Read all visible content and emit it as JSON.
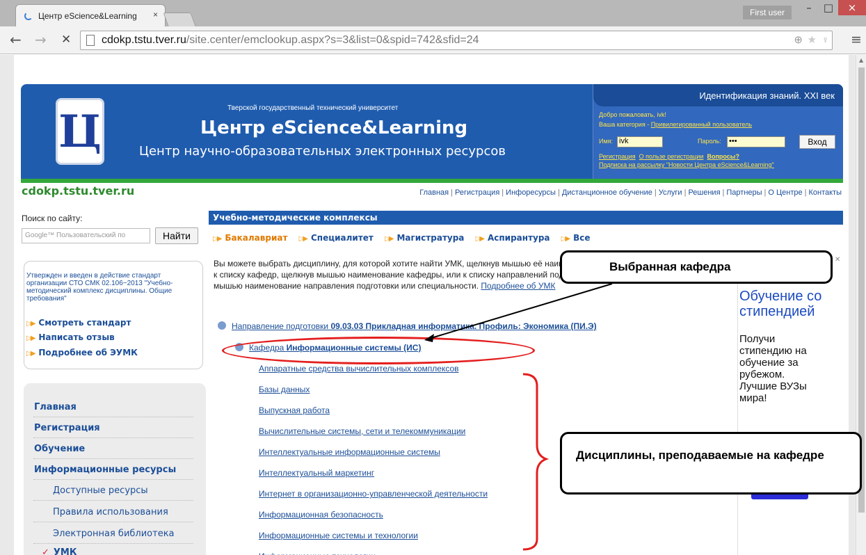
{
  "browser": {
    "tab_title": "Центр eScience&Learning",
    "tab_close": "×",
    "profile_name": "First user",
    "minimize": "–",
    "maximize": "□",
    "close": "×",
    "back": "←",
    "forward": "→",
    "stop": "✕",
    "url_host": "cdokp.tstu.tver.ru",
    "url_path": "/site.center/emclookup.aspx?s=3&list=0&spid=742&sfid=24",
    "menu": "≡"
  },
  "banner": {
    "university": "Тверской государственный технический университет",
    "brand_prefix": "Центр ",
    "brand_italic": "e",
    "brand_suffix": "Science&Learning",
    "subtitle": "Центр научно-образовательных электронных ресурсов",
    "logo_letter": "Ц"
  },
  "auth": {
    "heading": "Идентификация знаний. XXI век",
    "welcome": "Добро пожаловать, ivk!",
    "category_label": "Ваша категория - ",
    "category_value": "Привилегированный пользователь",
    "name_label": "Имя:",
    "name_value": "ivk",
    "password_label": "Пароль:",
    "password_value": "•••",
    "login_button": "Вход",
    "register_link": "Регистрация",
    "benefit_link": "О пользе регистрации",
    "questions_link": "Вопросы?",
    "subscribe_link": "Подписка на рассылку \"Новости Центра eScience&Learning\""
  },
  "site_name": "cdokp.tstu.tver.ru",
  "topnav": [
    "Главная",
    "Регистрация",
    "Инфоресурсы",
    "Дистанционное обучение",
    "Услуги",
    "Решения",
    "Партнеры",
    "О Центре",
    "Контакты"
  ],
  "search": {
    "label": "Поиск по сайту:",
    "placeholder": "Google™ Пользовательский по",
    "button": "Найти"
  },
  "standard": {
    "text": "Утвержден и введен в действие стандарт организации СТО СМК 02.106−2013 \"Учебно-методический комплекс дисциплины. Общие требования\"",
    "links": [
      "Смотреть стандарт",
      "Написать отзыв",
      "Подробнее об ЭУМК"
    ]
  },
  "leftmenu": {
    "items": [
      "Главная",
      "Регистрация",
      "Обучение",
      "Информационные ресурсы"
    ],
    "subitems": [
      "Доступные ресурсы",
      "Правила использования",
      "Электронная библиотека"
    ],
    "current": "УМК"
  },
  "main": {
    "section_title": "Учебно-методические комплексы",
    "levels": [
      "Бакалавриат",
      "Специалитет",
      "Магистратура",
      "Аспирантура",
      "Все"
    ],
    "intro_text": "Вы можете выбрать дисциплину, для которой хотите найти УМК, щелкнув мышью её наименование в списке, или вернуться к списку кафедр, щелкнув мышью наименование кафедры, или к списку направлений подготовки/специальностей, щелкнув мышью наименование направления подготовки или специальности.",
    "intro_more": "Подробнее об УМК",
    "direction_label": "Направление подготовки ",
    "direction_value": "09.03.03 Прикладная информатика. Профиль: Экономика (ПИ.Э)",
    "department_label": "Кафедра ",
    "department_value": "Информационные системы (ИС)",
    "disciplines": [
      "Аппаратные средства вычислительных комплексов",
      "Базы данных",
      "Выпускная работа",
      "Вычислительные системы, сети и телекоммуникации",
      "Интеллектуальные информационные системы",
      "Интеллектуальный маркетинг",
      "Интернет в организационно-управленческой деятельности",
      "Информационная безопасность",
      "Информационные системы и технологии",
      "Информационные технологии"
    ]
  },
  "ad": {
    "line1": "Обучение со стипендией",
    "line2": "Получи стипендию на обучение за рубежом. Лучшие ВУЗы мира!"
  },
  "annotations": {
    "selected_department": "Выбранная кафедра",
    "disciplines_taught": "Дисциплины, преподаваемые на кафедре"
  }
}
